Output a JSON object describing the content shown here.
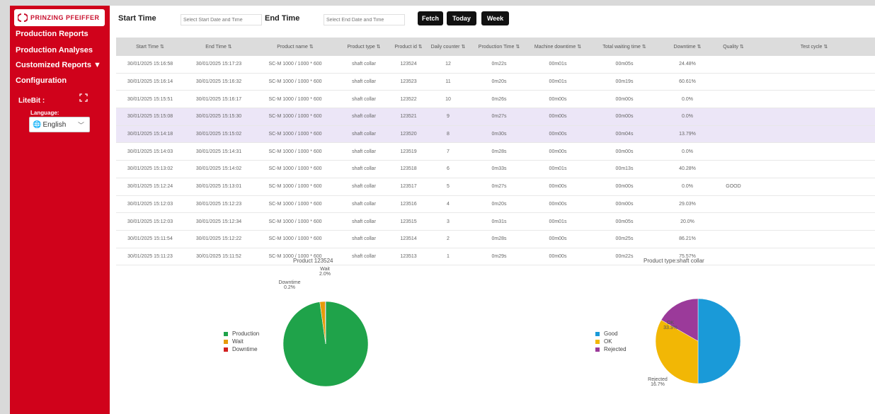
{
  "colors": {
    "sidebar": "#d0021b",
    "production": "#1fa34a",
    "wait": "#e69b0a",
    "downtime": "#d22020",
    "good": "#1a9ad8",
    "ok": "#f2b705",
    "rejected": "#9b3a9a"
  },
  "sidebar": {
    "logo_text": "PRINZING PFEIFFER",
    "items": [
      {
        "label": "Production Reports"
      },
      {
        "label": "Production Analyses"
      },
      {
        "label": "Customized Reports ▼"
      },
      {
        "label": "Configuration"
      }
    ],
    "litebit_label": "LiteBit :",
    "language_label": "Language:",
    "language_value": "English",
    "icons": [
      "fullscreen-icon",
      "globe-icon",
      "chevron-down-icon"
    ]
  },
  "toolbar": {
    "start_label": "Start Time",
    "start_placeholder": "Select Start Date and Time",
    "end_label": "End Time",
    "end_placeholder": "Select End Date and Time",
    "fetch": "Fetch",
    "today": "Today",
    "week": "Week"
  },
  "table": {
    "columns": [
      "Start Time ⇅",
      "End Time ⇅",
      "Product name ⇅",
      "Product type ⇅",
      "Product id ⇅",
      "Daily counter ⇅",
      "Production Time ⇅",
      "Machine downtime ⇅",
      "Total waiting time ⇅",
      "Downtime ⇅",
      "Quality ⇅",
      "Test cycle ⇅"
    ],
    "rows": [
      [
        "30/01/2025 15:16:58",
        "30/01/2025 15:17:23",
        "SC-M 1000 / 1000 * 600",
        "shaft collar",
        "123524",
        "12",
        "0m22s",
        "00m01s",
        "00m05s",
        "24.48%",
        "",
        ""
      ],
      [
        "30/01/2025 15:16:14",
        "30/01/2025 15:16:32",
        "SC-M 1000 / 1000 * 600",
        "shaft collar",
        "123523",
        "11",
        "0m20s",
        "00m01s",
        "00m19s",
        "60.61%",
        "",
        ""
      ],
      [
        "30/01/2025 15:15:51",
        "30/01/2025 15:16:17",
        "SC-M 1000 / 1000 * 600",
        "shaft collar",
        "123522",
        "10",
        "0m26s",
        "00m00s",
        "00m00s",
        "0.0%",
        "",
        ""
      ],
      [
        "30/01/2025 15:15:08",
        "30/01/2025 15:15:30",
        "SC-M 1000 / 1000 * 600",
        "shaft collar",
        "123521",
        "9",
        "0m27s",
        "00m00s",
        "00m00s",
        "0.0%",
        "",
        ""
      ],
      [
        "30/01/2025 15:14:18",
        "30/01/2025 15:15:02",
        "SC-M 1000 / 1000 * 600",
        "shaft collar",
        "123520",
        "8",
        "0m30s",
        "00m00s",
        "00m04s",
        "13.79%",
        "",
        ""
      ],
      [
        "30/01/2025 15:14:03",
        "30/01/2025 15:14:31",
        "SC-M 1000 / 1000 * 600",
        "shaft collar",
        "123519",
        "7",
        "0m28s",
        "00m00s",
        "00m00s",
        "0.0%",
        "",
        ""
      ],
      [
        "30/01/2025 15:13:02",
        "30/01/2025 15:14:02",
        "SC-M 1000 / 1000 * 600",
        "shaft collar",
        "123518",
        "6",
        "0m33s",
        "00m01s",
        "00m13s",
        "40.28%",
        "",
        ""
      ],
      [
        "30/01/2025 15:12:24",
        "30/01/2025 15:13:01",
        "SC-M 1000 / 1000 * 600",
        "shaft collar",
        "123517",
        "5",
        "0m27s",
        "00m00s",
        "00m00s",
        "0.0%",
        "GOOD",
        ""
      ],
      [
        "30/01/2025 15:12:03",
        "30/01/2025 15:12:23",
        "SC-M 1000 / 1000 * 600",
        "shaft collar",
        "123516",
        "4",
        "0m20s",
        "00m00s",
        "00m00s",
        "29.03%",
        "",
        ""
      ],
      [
        "30/01/2025 15:12:03",
        "30/01/2025 15:12:34",
        "SC-M 1000 / 1000 * 600",
        "shaft collar",
        "123515",
        "3",
        "0m31s",
        "00m01s",
        "00m05s",
        "20.0%",
        "",
        ""
      ],
      [
        "30/01/2025 15:11:54",
        "30/01/2025 15:12:22",
        "SC-M 1000 / 1000 * 600",
        "shaft collar",
        "123514",
        "2",
        "0m28s",
        "00m00s",
        "00m25s",
        "86.21%",
        "",
        ""
      ],
      [
        "30/01/2025 15:11:23",
        "30/01/2025 15:11:52",
        "SC-M 1000 / 1000 * 600",
        "shaft collar",
        "123513",
        "1",
        "0m29s",
        "00m00s",
        "00m22s",
        "75.57%",
        "",
        ""
      ]
    ],
    "selected_rows": [
      3,
      4
    ]
  },
  "chart_data": [
    {
      "type": "pie",
      "title": "Product 123524",
      "labels": [
        "Production",
        "Wait",
        "Downtime"
      ],
      "values": [
        97.8,
        2.0,
        0.2
      ],
      "value_labels": [
        "",
        "2.0%",
        "0.2%"
      ],
      "legend_position": "left"
    },
    {
      "type": "pie",
      "title": "Product type:shaft collar",
      "labels": [
        "Good",
        "OK",
        "Rejected"
      ],
      "values": [
        50.0,
        33.3,
        16.7
      ],
      "value_labels": [
        "",
        "33.3%",
        "16.7%"
      ],
      "legend_position": "left"
    }
  ]
}
